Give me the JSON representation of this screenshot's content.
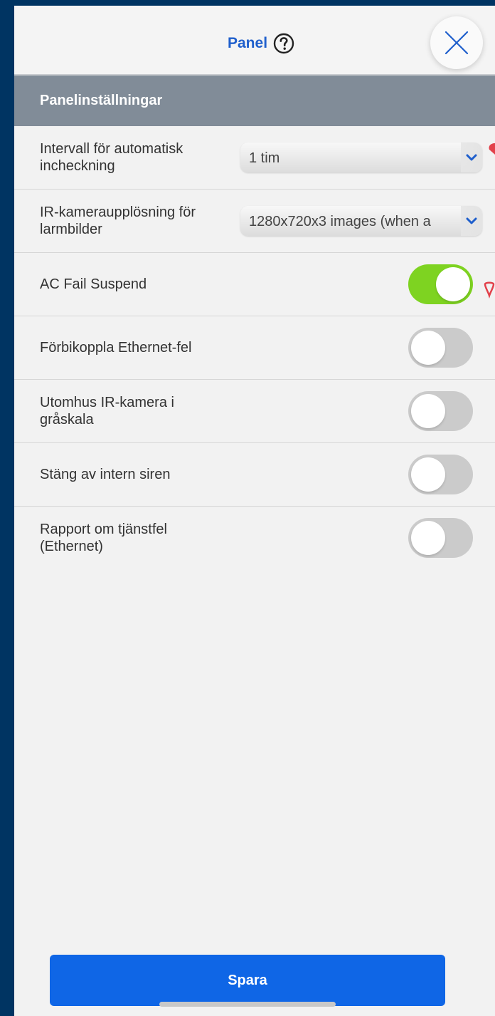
{
  "header": {
    "title": "Panel",
    "help_icon": "question-circle-icon",
    "close_icon": "close-x-icon"
  },
  "section": {
    "title": "Panelinställningar"
  },
  "settings": [
    {
      "label": "Intervall för automatisk incheckning",
      "type": "select",
      "value": "1 tim"
    },
    {
      "label": "IR-kameraupplösning för larmbilder",
      "type": "select",
      "value": "1280x720x3 images (when a"
    },
    {
      "label": "AC Fail Suspend",
      "type": "toggle",
      "on": true
    },
    {
      "label": "Förbikoppla Ethernet-fel",
      "type": "toggle",
      "on": false
    },
    {
      "label": "Utomhus IR-kamera i gråskala",
      "type": "toggle",
      "on": false
    },
    {
      "label": "Stäng av intern siren",
      "type": "toggle",
      "on": false
    },
    {
      "label": "Rapport om tjänstfel (Ethernet)",
      "type": "toggle",
      "on": false
    }
  ],
  "footer": {
    "save_label": "Spara"
  },
  "colors": {
    "accent": "#0f66e6",
    "toggle_on": "#7ed321",
    "section_bg": "#818c98",
    "marker": "#e2404a"
  }
}
